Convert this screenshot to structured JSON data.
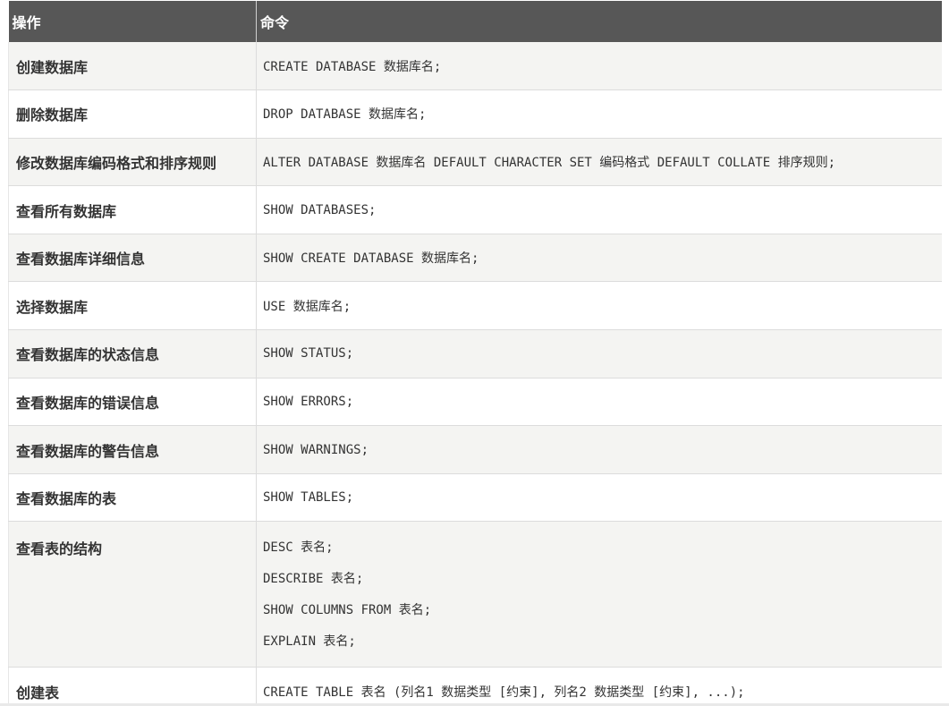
{
  "table": {
    "headers": [
      "操作",
      "命令"
    ],
    "rows": [
      {
        "op": "创建数据库",
        "cmd": [
          "CREATE DATABASE 数据库名;"
        ]
      },
      {
        "op": "删除数据库",
        "cmd": [
          "DROP DATABASE 数据库名;"
        ]
      },
      {
        "op": "修改数据库编码格式和排序规则",
        "cmd": [
          "ALTER DATABASE 数据库名 DEFAULT CHARACTER SET 编码格式 DEFAULT COLLATE 排序规则;"
        ]
      },
      {
        "op": "查看所有数据库",
        "cmd": [
          "SHOW DATABASES;"
        ]
      },
      {
        "op": "查看数据库详细信息",
        "cmd": [
          "SHOW CREATE DATABASE 数据库名;"
        ]
      },
      {
        "op": "选择数据库",
        "cmd": [
          "USE 数据库名;"
        ]
      },
      {
        "op": "查看数据库的状态信息",
        "cmd": [
          "SHOW STATUS;"
        ]
      },
      {
        "op": "查看数据库的错误信息",
        "cmd": [
          "SHOW ERRORS;"
        ]
      },
      {
        "op": "查看数据库的警告信息",
        "cmd": [
          "SHOW WARNINGS;"
        ]
      },
      {
        "op": "查看数据库的表",
        "cmd": [
          "SHOW TABLES;"
        ]
      },
      {
        "op": "查看表的结构",
        "cmd": [
          "DESC 表名;",
          "DESCRIBE 表名;",
          "SHOW COLUMNS FROM 表名;",
          "EXPLAIN 表名;"
        ]
      },
      {
        "op": "创建表",
        "cmd": [
          "CREATE TABLE 表名 (列名1 数据类型 [约束], 列名2 数据类型 [约束], ...);"
        ]
      }
    ]
  },
  "colors": {
    "header_bg": "#575757",
    "header_text": "#ffffff",
    "row_odd_bg": "#f4f4f2",
    "row_even_bg": "#ffffff",
    "border": "#dcdcdc"
  }
}
